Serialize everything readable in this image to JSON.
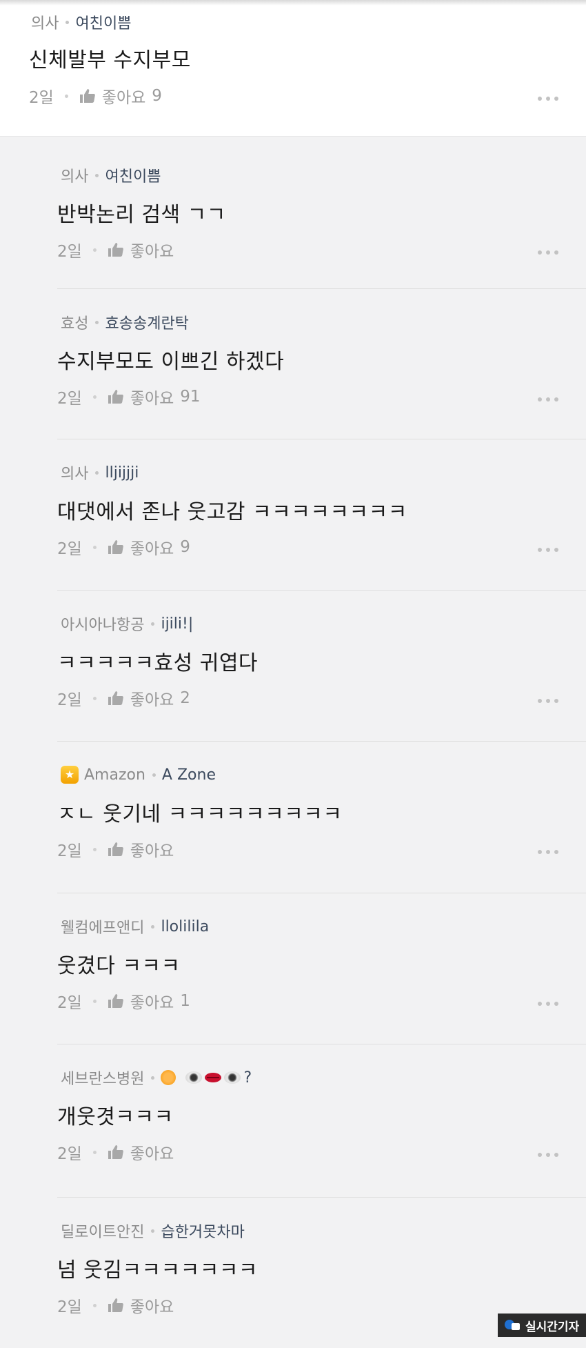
{
  "parent_comment": {
    "company": "의사",
    "nickname": "여친이쁨",
    "text": "신체발부 수지부모",
    "time": "2일",
    "like_label": "좋아요",
    "like_count": "9"
  },
  "replies": [
    {
      "company": "의사",
      "nickname": "여친이쁨",
      "text": "반박논리 검색 ㄱㄱ",
      "time": "2일",
      "like_label": "좋아요",
      "like_count": ""
    },
    {
      "company": "효성",
      "nickname": "효송송계란탁",
      "text": "수지부모도 이쁘긴 하겠다",
      "time": "2일",
      "like_label": "좋아요",
      "like_count": "91"
    },
    {
      "company": "의사",
      "nickname": "lljijjji",
      "text": "대댓에서 존나 웃고감 ㅋㅋㅋㅋㅋㅋㅋㅋ",
      "time": "2일",
      "like_label": "좋아요",
      "like_count": "9"
    },
    {
      "company": "아시아나항공",
      "nickname": "ijili!|",
      "text": "ㅋㅋㅋㅋㅋ효성 귀엽다",
      "time": "2일",
      "like_label": "좋아요",
      "like_count": "2"
    },
    {
      "company": "Amazon",
      "nickname": "A Zone",
      "text": "ㅈㄴ 웃기네 ㅋㅋㅋㅋㅋㅋㅋㅋㅋ",
      "time": "2일",
      "like_label": "좋아요",
      "like_count": "",
      "badge_icon": "trophy-icon"
    },
    {
      "company": "웰컴에프앤디",
      "nickname": "llolilila",
      "text": "웃겼다 ㅋㅋㅋ",
      "time": "2일",
      "like_label": "좋아요",
      "like_count": "1"
    },
    {
      "company": "세브란스병원",
      "nickname": "?",
      "nickname_icons": [
        "sun-emoji",
        "eye-emoji",
        "lips-emoji",
        "eye-emoji"
      ],
      "text": "개웃겻ㅋㅋㅋ",
      "time": "2일",
      "like_label": "좋아요",
      "like_count": ""
    },
    {
      "company": "딜로이트안진",
      "nickname": "습한거못차마",
      "text": "넘 웃김ㅋㅋㅋㅋㅋㅋㅋ",
      "time": "2일",
      "like_label": "좋아요",
      "like_count": ""
    }
  ],
  "icons": {
    "like": "thumbs-up-icon",
    "more": "more-options-icon"
  },
  "watermark": {
    "text": "실시간기자"
  },
  "colors": {
    "background": "#f2f2f3",
    "parent_background": "#ffffff",
    "company_text": "#8b8b8b",
    "nickname_text": "#3c4a5e",
    "meta_gray": "#9a9a9a"
  }
}
